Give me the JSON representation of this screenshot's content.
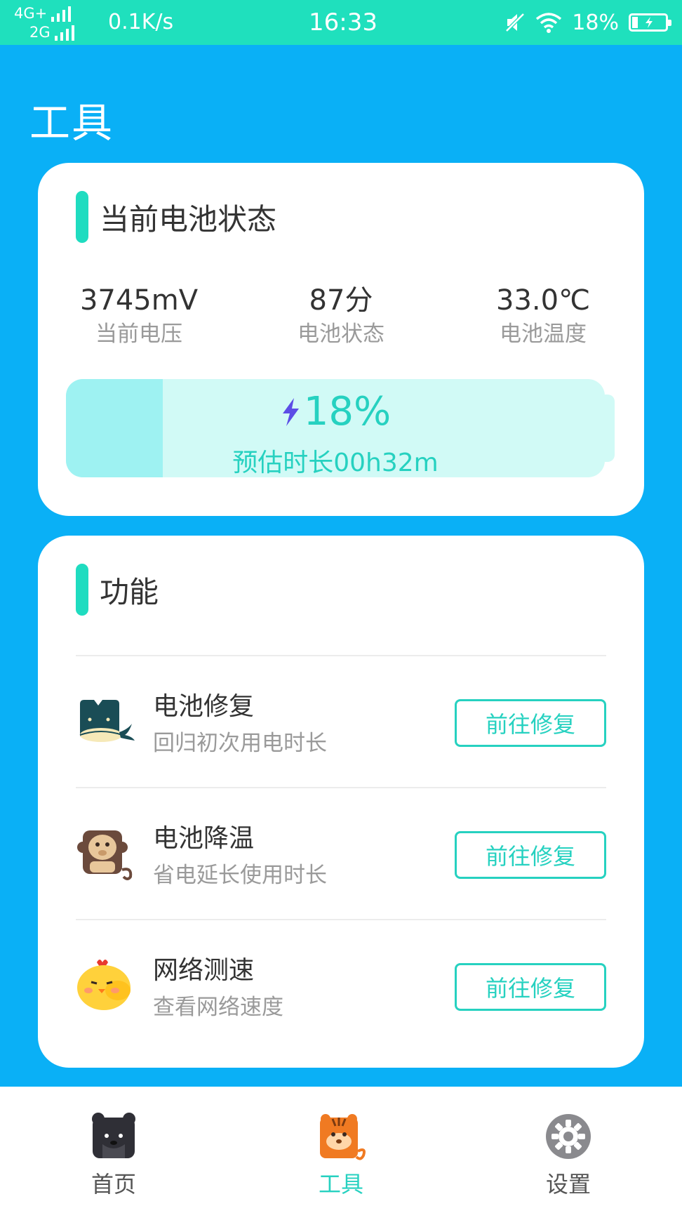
{
  "status_bar": {
    "network_1": "4G+",
    "network_2": "2G",
    "speed": "0.1K/s",
    "time": "16:33",
    "battery_percent": "18%",
    "icons": [
      "signal-icon",
      "mute-icon",
      "wifi-icon",
      "battery-charging-icon"
    ]
  },
  "page_title": "工具",
  "battery_card": {
    "title": "当前电池状态",
    "stats": [
      {
        "value": "3745mV",
        "label": "当前电压"
      },
      {
        "value": "87分",
        "label": "电池状态"
      },
      {
        "value": "33.0℃",
        "label": "电池温度"
      }
    ],
    "level_fraction": 0.18,
    "percent_text": "18%",
    "estimate_text": "预估时长00h32m"
  },
  "functions_card": {
    "title": "功能",
    "items": [
      {
        "title": "电池修复",
        "subtitle": "回归初次用电时长",
        "button": "前往修复",
        "icon": "whale-icon"
      },
      {
        "title": "电池降温",
        "subtitle": "省电延长使用时长",
        "button": "前往修复",
        "icon": "monkey-icon"
      },
      {
        "title": "网络测速",
        "subtitle": "查看网络速度",
        "button": "前往修复",
        "icon": "chick-icon"
      }
    ]
  },
  "bottom_nav": {
    "items": [
      {
        "label": "首页",
        "icon": "bear-icon"
      },
      {
        "label": "工具",
        "icon": "tiger-icon",
        "active": true
      },
      {
        "label": "设置",
        "icon": "gear-icon"
      }
    ]
  },
  "colors": {
    "background": "#0ab0f6",
    "status_bar": "#1fe0bd",
    "accent": "#26d1c0",
    "battery_fill": "#9ef2f2",
    "battery_track": "#d1faf6"
  }
}
